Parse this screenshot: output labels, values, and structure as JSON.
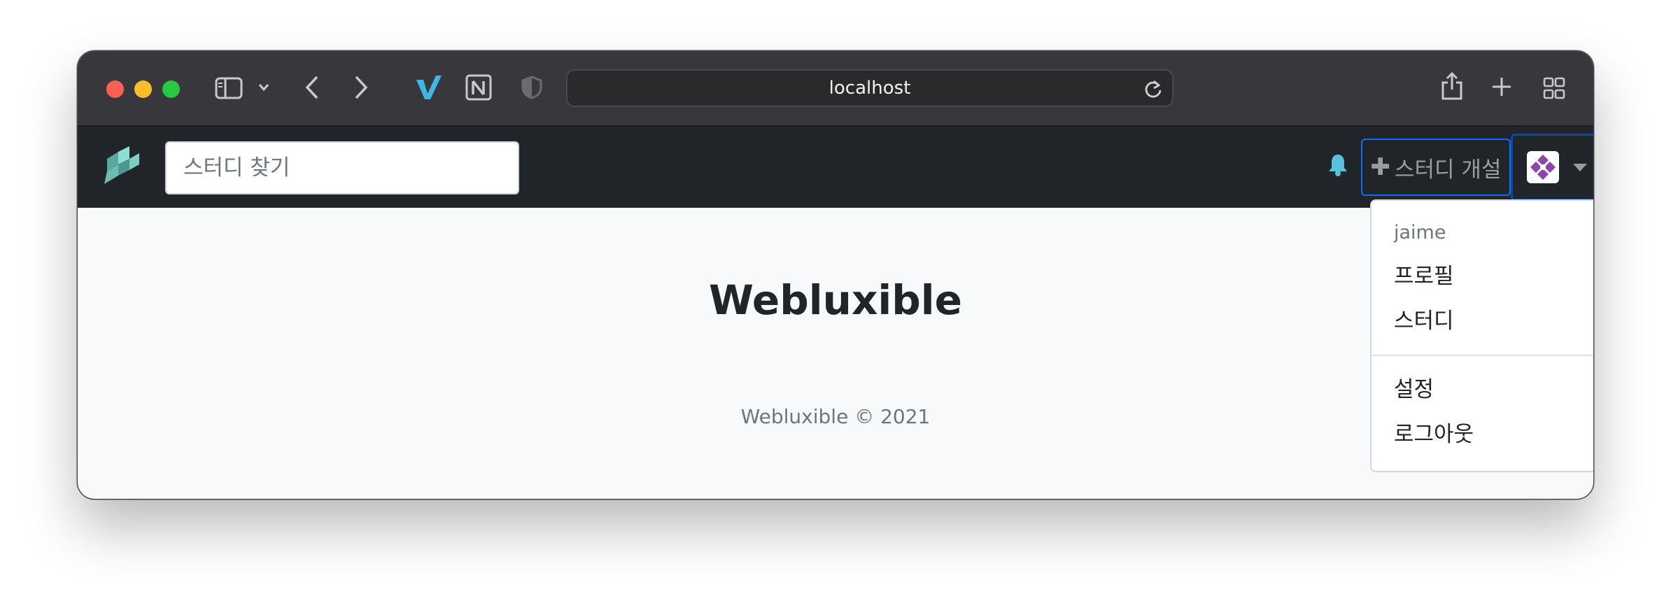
{
  "browser": {
    "url": "localhost"
  },
  "navbar": {
    "search_placeholder": "스터디 찾기",
    "create_study_label": "스터디 개설"
  },
  "main": {
    "title": "Webluxible",
    "footer": "Webluxible © 2021"
  },
  "user_menu": {
    "username": "jaime",
    "items": [
      "프로필",
      "스터디",
      "설정",
      "로그아웃"
    ]
  },
  "colors": {
    "navbar_bg": "#212529",
    "primary": "#0d6efd",
    "bell": "#5bc0de",
    "logo": "#7ccfc4",
    "avatar": "#8e44ad"
  }
}
